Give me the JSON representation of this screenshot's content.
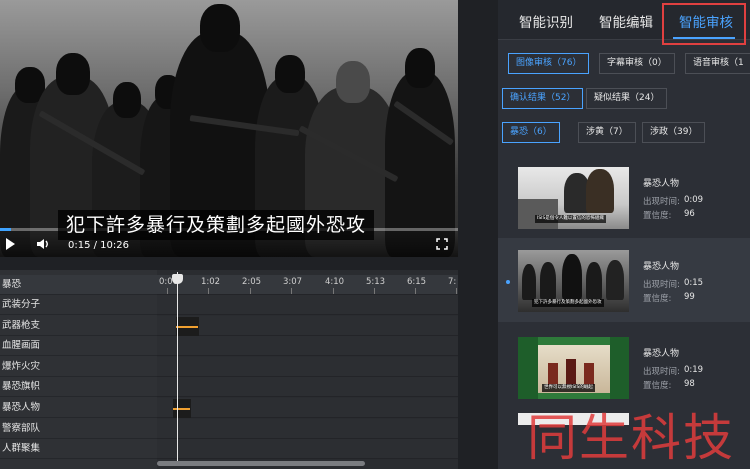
{
  "video": {
    "subtitle": "犯下許多暴行及策劃多起國外恐攻",
    "time": "0:15 / 10:26",
    "progress_fraction": 0.025
  },
  "timeline": {
    "labels": [
      "暴恐",
      "武装分子",
      "武器枪支",
      "血腥画面",
      "爆炸火灾",
      "暴恐旗帜",
      "暴恐人物",
      "警察部队",
      "人群聚集"
    ],
    "ticks": [
      "0:00",
      "1:02",
      "2:05",
      "3:07",
      "4:10",
      "5:13",
      "6:15",
      "7:"
    ]
  },
  "right": {
    "tabs": [
      "智能识别",
      "智能编辑",
      "智能审核"
    ],
    "active_tab": 2,
    "chips_row1": [
      "图像审核（76）",
      "字幕审核（0）",
      "语音审核（1"
    ],
    "chips_row2": [
      "确认结果（52）",
      "疑似结果（24）"
    ],
    "chips_row3": [
      "暴恐（6）",
      "涉黄（7）",
      "涉政（39）"
    ],
    "items": [
      {
        "title": "暴恐人物",
        "time_label": "出现时间:",
        "time": "0:09",
        "conf_label": "置信度:",
        "conf": "96",
        "caption": "ISIS是個令人難以置信的恐怖組織"
      },
      {
        "title": "暴恐人物",
        "time_label": "出现时间:",
        "time": "0:15",
        "conf_label": "置信度:",
        "conf": "99",
        "caption": "犯下許多暴行及策劃多起國外恐攻"
      },
      {
        "title": "暴恐人物",
        "time_label": "出现时间:",
        "time": "0:19",
        "conf_label": "置信度:",
        "conf": "98",
        "caption": "世界可以無視ISIS的崛起"
      }
    ]
  },
  "watermark": "同生科技",
  "colors": {
    "accent": "#4aa3ff",
    "highlight_box": "#e04040",
    "segment": "#f0a030"
  }
}
